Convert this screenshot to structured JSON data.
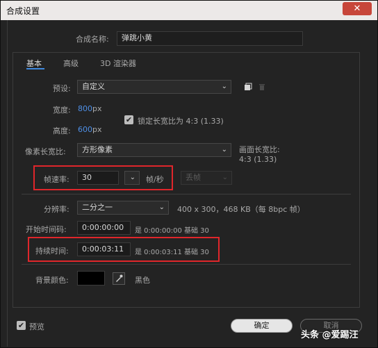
{
  "window": {
    "title": "合成设置",
    "close_icon": "✕"
  },
  "comp_name": {
    "label": "合成名称:",
    "value": "弹跳小黄"
  },
  "tabs": [
    {
      "label": "基本"
    },
    {
      "label": "高级"
    },
    {
      "label": "3D 渲染器"
    }
  ],
  "preset": {
    "label": "预设:",
    "value": "自定义"
  },
  "width": {
    "label": "宽度:",
    "value": "800",
    "unit": "px"
  },
  "height": {
    "label": "高度:",
    "value": "600",
    "unit": "px"
  },
  "lock_aspect": {
    "label": "锁定长宽比为 4:3 (1.33)",
    "checked": true
  },
  "pixel_aspect": {
    "label": "像素长宽比:",
    "value": "方形像素"
  },
  "frame_aspect": {
    "label": "画面长宽比:",
    "value": "4:3 (1.33)"
  },
  "frame_rate": {
    "label": "帧速率:",
    "value": "30",
    "unit": "帧/秒",
    "drop_frame": "丢帧"
  },
  "resolution": {
    "label": "分辨率:",
    "value": "二分之一",
    "info": "400 x 300，468 KB（每 8bpc 帧）"
  },
  "start_timecode": {
    "label": "开始时间码:",
    "value": "0:00:00:00",
    "info": "是 0:00:00:00  基础 30"
  },
  "duration": {
    "label": "持续时间:",
    "value": "0:00:03:11",
    "info": "是 0:00:03:11  基础 30"
  },
  "bg_color": {
    "label": "背景颜色:",
    "name": "黑色",
    "swatch": "#000000"
  },
  "preview": {
    "label": "预览",
    "checked": true
  },
  "buttons": {
    "ok": "确定",
    "cancel": "取消"
  },
  "watermark": "头条 @爱踢汪",
  "icons": {
    "check": "✔",
    "chevron": "⌄",
    "eyedropper": "eyedropper-icon",
    "new_preset": "new-preset-icon",
    "delete_preset": "trash-icon"
  }
}
